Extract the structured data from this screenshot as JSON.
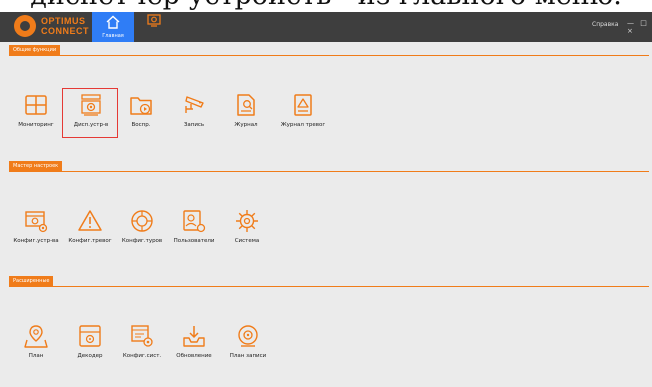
{
  "caption": "диспетчер устройств - из главного меню.",
  "app": {
    "logo_line1": "OPTIMUS",
    "logo_line2": "CONNECT",
    "nav_home": "Главная",
    "help": "Справка",
    "window_controls": "— □ ×"
  },
  "sections": [
    {
      "title": "Общие функции",
      "items": [
        {
          "label": "Мониторинг",
          "icon": "monitoring-icon"
        },
        {
          "label": "Дисп.устр-в",
          "icon": "device-manager-icon",
          "selected": true
        },
        {
          "label": "Воспр.",
          "icon": "playback-icon"
        },
        {
          "label": "Запись",
          "icon": "record-icon"
        },
        {
          "label": "Журнал",
          "icon": "log-icon"
        },
        {
          "label": "Журнал тревог",
          "icon": "alarm-log-icon"
        }
      ]
    },
    {
      "title": "Мастер настроек",
      "items": [
        {
          "label": "Конфиг.устр-ва",
          "icon": "device-config-icon"
        },
        {
          "label": "Конфиг.тревог",
          "icon": "alarm-config-icon"
        },
        {
          "label": "Конфиг.туров",
          "icon": "tour-config-icon"
        },
        {
          "label": "Пользователи",
          "icon": "users-icon"
        },
        {
          "label": "Система",
          "icon": "system-gear-icon"
        }
      ]
    },
    {
      "title": "Расширенные",
      "items": [
        {
          "label": "План",
          "icon": "map-plan-icon"
        },
        {
          "label": "Декодер",
          "icon": "decoder-icon"
        },
        {
          "label": "Конфиг.сист.",
          "icon": "system-config-icon"
        },
        {
          "label": "Обновление",
          "icon": "update-icon"
        },
        {
          "label": "План записи",
          "icon": "record-plan-icon"
        }
      ]
    }
  ],
  "colors": {
    "accent": "#f07c1a",
    "topbar": "#3e3e3e",
    "active_tab": "#2f7df6",
    "selection": "#e53935",
    "background": "#ebebeb"
  }
}
